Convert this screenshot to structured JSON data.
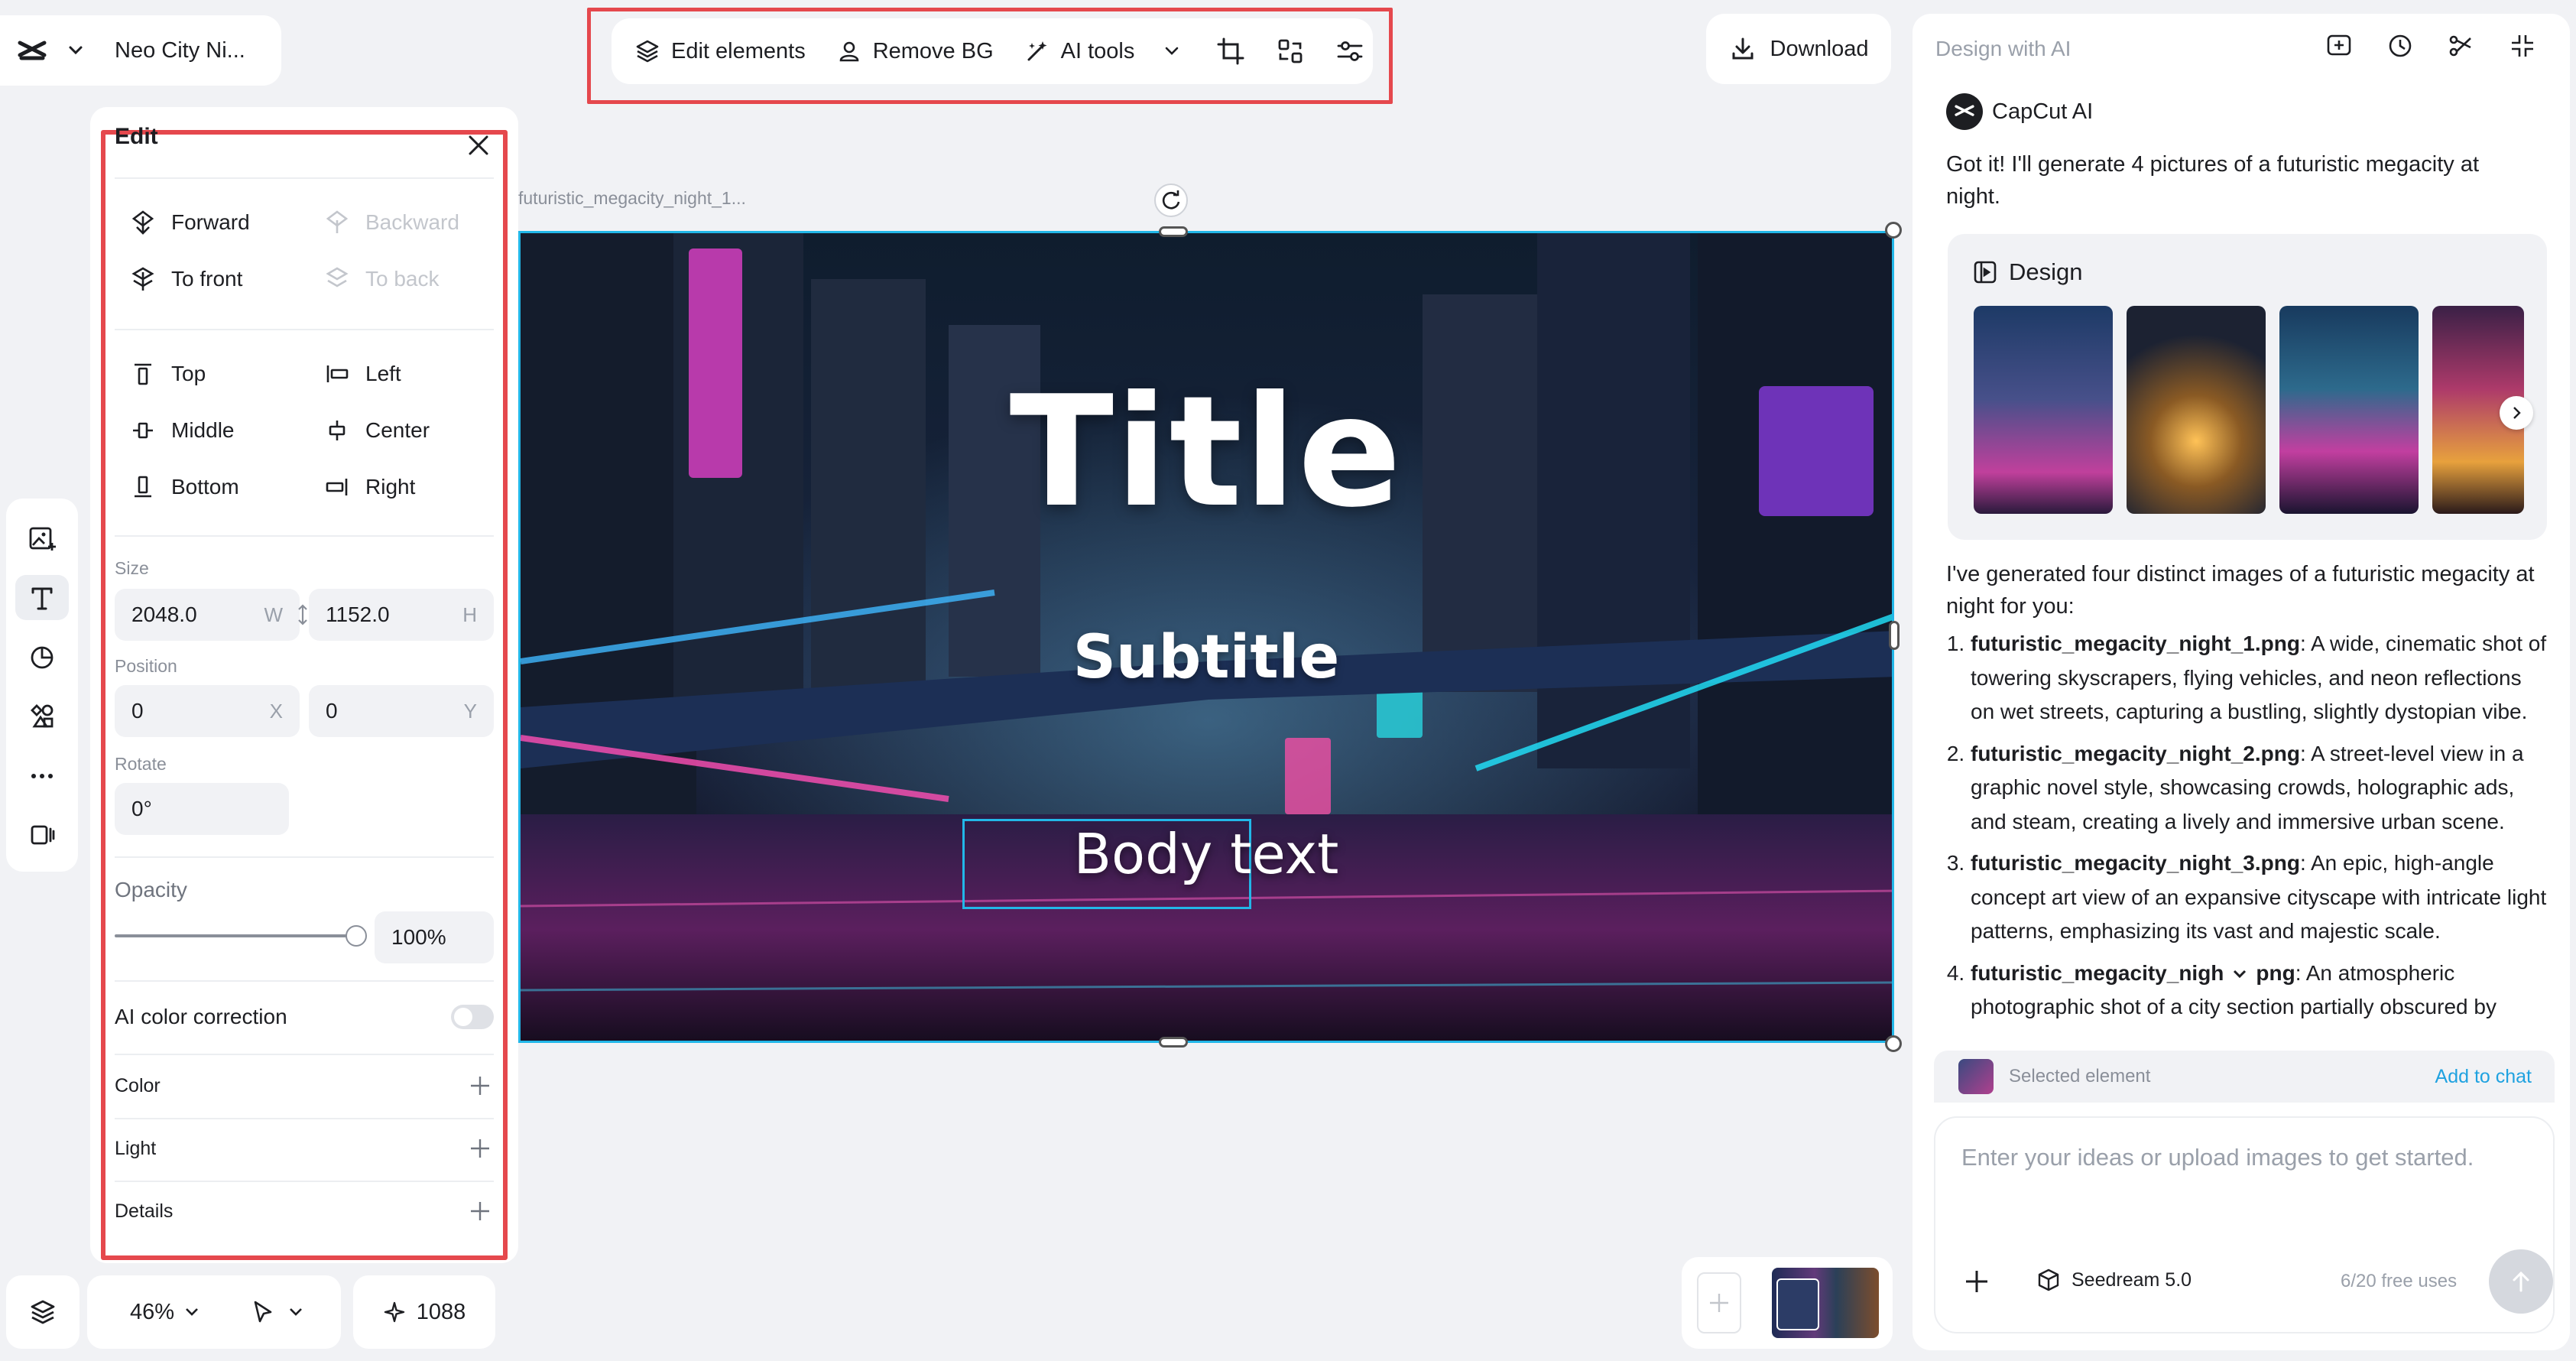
{
  "project": {
    "name": "Neo City Ni..."
  },
  "toolbar": {
    "edit_elements": "Edit elements",
    "remove_bg": "Remove BG",
    "ai_tools": "AI tools"
  },
  "download": "Download",
  "edit_panel": {
    "title": "Edit",
    "arrange": {
      "forward": "Forward",
      "backward": "Backward",
      "to_front": "To front",
      "to_back": "To back"
    },
    "align": {
      "top": "Top",
      "left": "Left",
      "middle": "Middle",
      "center": "Center",
      "bottom": "Bottom",
      "right": "Right"
    },
    "size_label": "Size",
    "width": "2048.0",
    "width_unit": "W",
    "height": "1152.0",
    "height_unit": "H",
    "position_label": "Position",
    "x": "0",
    "x_unit": "X",
    "y": "0",
    "y_unit": "Y",
    "rotate_label": "Rotate",
    "rotate": "0°",
    "opacity_label": "Opacity",
    "opacity": "100%",
    "opacity_fraction": 1.0,
    "ai_color_correction": "AI color correction",
    "color": "Color",
    "light": "Light",
    "details": "Details"
  },
  "canvas": {
    "file_label": "futuristic_megacity_night_1...",
    "title": "Title",
    "subtitle": "Subtitle",
    "body": "Body text"
  },
  "bottom": {
    "zoom": "46%",
    "credits": "1088"
  },
  "ai_panel": {
    "header": "Design with AI",
    "assistant": "CapCut AI",
    "msg1": "Got it! I'll generate 4 pictures of a futuristic megacity at night.",
    "design_label": "Design",
    "msg2": "I've generated four distinct images of a futuristic megacity at night for you:",
    "items": [
      {
        "name": "futuristic_megacity_night_1.png",
        "desc": ": A wide, cinematic shot of towering skyscrapers, flying vehicles, and neon reflections on wet streets, capturing a bustling, slightly dystopian vibe."
      },
      {
        "name": "futuristic_megacity_night_2.png",
        "desc": ": A street-level view in a graphic novel style, showcasing crowds, holographic ads, and steam, creating a lively and immersive urban scene."
      },
      {
        "name": "futuristic_megacity_night_3.png",
        "desc": ": An epic, high-angle concept art view of an expansive cityscape with intricate light patterns, emphasizing its vast and majestic scale."
      },
      {
        "name": "futuristic_megacity_nigh",
        "name_end": "png",
        "desc": ": An atmospheric photographic shot of a city section partially obscured by"
      }
    ],
    "selected_element": "Selected element",
    "add_to_chat": "Add to chat",
    "input_placeholder": "Enter your ideas or upload images to get started.",
    "model": "Seedream 5.0",
    "free_uses": "6/20 free uses"
  },
  "colors": {
    "accent_blue": "#22b7e8",
    "highlight_red": "#e5484d",
    "link_blue": "#1fa2e0"
  }
}
